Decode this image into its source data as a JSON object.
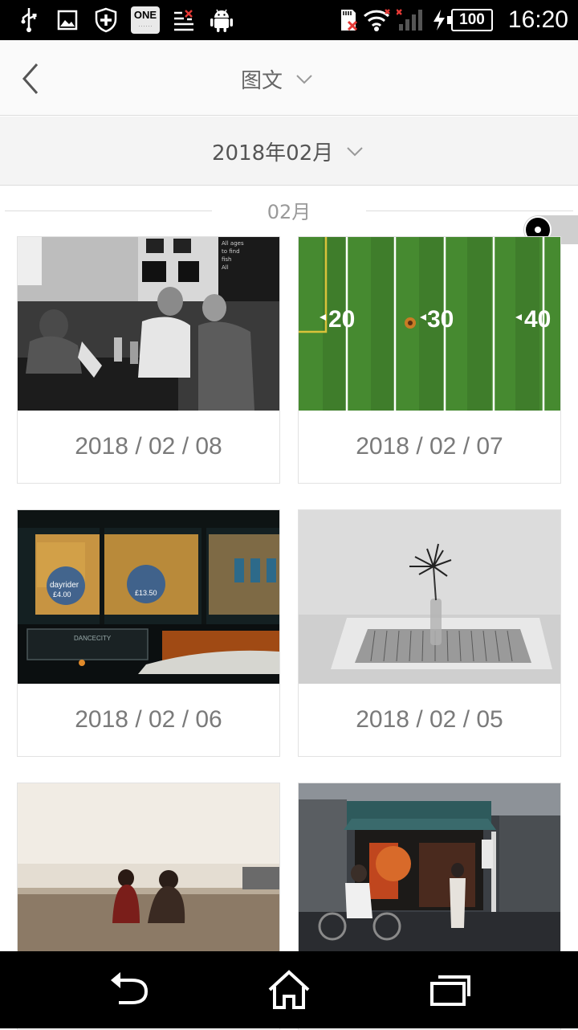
{
  "status_bar": {
    "time": "16:20",
    "battery": "100",
    "one_badge": "ONE",
    "icons": [
      "usb-icon",
      "image-icon",
      "shield-plus-icon",
      "one-app-icon",
      "list-x-icon",
      "android-icon",
      "sd-card-error-icon",
      "wifi-icon",
      "signal-icon",
      "charging-icon"
    ]
  },
  "header": {
    "back_icon": "chevron-left-icon",
    "title": "图文",
    "title_icon": "chevron-down-icon"
  },
  "date_filter": {
    "value": "2018年02月",
    "icon": "chevron-down-icon"
  },
  "month_label": "02月",
  "cards": [
    {
      "date": "2018 / 02 / 08"
    },
    {
      "date": "2018 / 02 / 07"
    },
    {
      "date": "2018 / 02 / 06"
    },
    {
      "date": "2018 / 02 / 05"
    },
    {
      "date": ""
    },
    {
      "date": ""
    }
  ],
  "football": {
    "yard_left": "20",
    "yard_mid": "30",
    "yard_right": "40"
  },
  "nav_bar": {
    "icons": [
      "back-arrow-icon",
      "home-icon",
      "recent-apps-icon"
    ]
  }
}
